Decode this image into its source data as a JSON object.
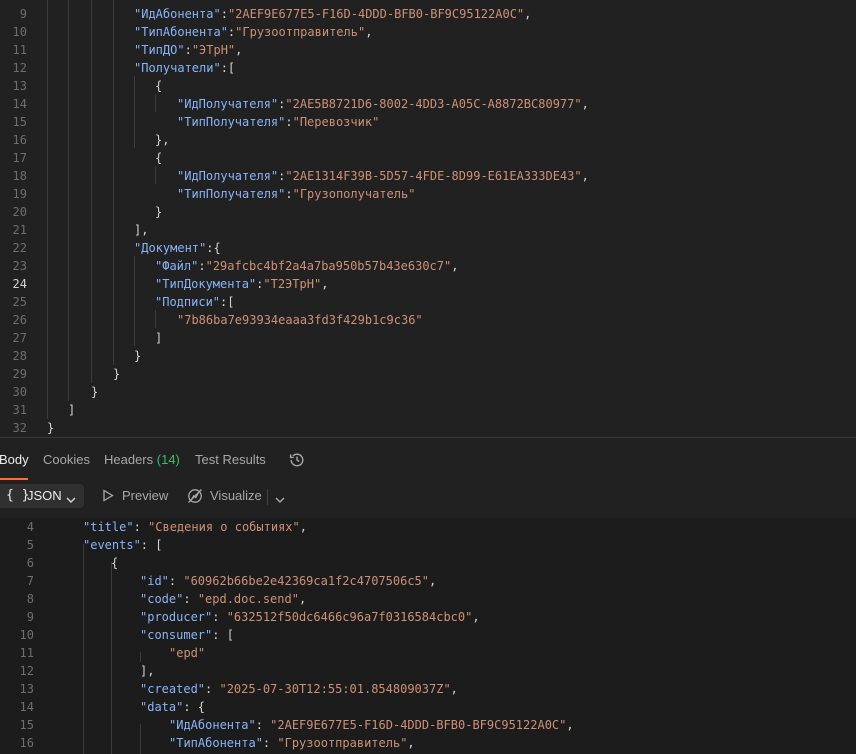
{
  "request_body": {
    "lines": [
      {
        "n": "9",
        "tokens": [
          [
            "k",
            "\"ИдАбонента\""
          ],
          [
            "p",
            ":"
          ],
          [
            "s",
            "\"2AEF9E677E5-F16D-4DDD-BFB0-BF9C95122A0C\""
          ],
          [
            "p",
            ","
          ]
        ]
      },
      {
        "n": "10",
        "tokens": [
          [
            "k",
            "\"ТипАбонента\""
          ],
          [
            "p",
            ":"
          ],
          [
            "s",
            "\"Грузоотправитель\""
          ],
          [
            "p",
            ","
          ]
        ]
      },
      {
        "n": "11",
        "tokens": [
          [
            "k",
            "\"ТипДО\""
          ],
          [
            "p",
            ":"
          ],
          [
            "s",
            "\"ЭТрН\""
          ],
          [
            "p",
            ","
          ]
        ]
      },
      {
        "n": "12",
        "tokens": [
          [
            "k",
            "\"Получатели\""
          ],
          [
            "p",
            ":["
          ]
        ]
      },
      {
        "n": "13",
        "tokens": [
          [
            "p",
            "{"
          ]
        ]
      },
      {
        "n": "14",
        "tokens": [
          [
            "k",
            "\"ИдПолучателя\""
          ],
          [
            "p",
            ":"
          ],
          [
            "s",
            "\"2AE5B8721D6-8002-4DD3-A05C-A8872BC80977\""
          ],
          [
            "p",
            ","
          ]
        ]
      },
      {
        "n": "15",
        "tokens": [
          [
            "k",
            "\"ТипПолучателя\""
          ],
          [
            "p",
            ":"
          ],
          [
            "s",
            "\"Перевозчик\""
          ]
        ]
      },
      {
        "n": "16",
        "tokens": [
          [
            "p",
            "},"
          ]
        ]
      },
      {
        "n": "17",
        "tokens": [
          [
            "p",
            "{"
          ]
        ]
      },
      {
        "n": "18",
        "tokens": [
          [
            "k",
            "\"ИдПолучателя\""
          ],
          [
            "p",
            ":"
          ],
          [
            "s",
            "\"2AE1314F39B-5D57-4FDE-8D99-E61EA333DE43\""
          ],
          [
            "p",
            ","
          ]
        ]
      },
      {
        "n": "19",
        "tokens": [
          [
            "k",
            "\"ТипПолучателя\""
          ],
          [
            "p",
            ":"
          ],
          [
            "s",
            "\"Грузополучатель\""
          ]
        ]
      },
      {
        "n": "20",
        "tokens": [
          [
            "p",
            "}"
          ]
        ]
      },
      {
        "n": "21",
        "tokens": [
          [
            "p",
            "],"
          ]
        ]
      },
      {
        "n": "22",
        "tokens": [
          [
            "k",
            "\"Документ\""
          ],
          [
            "p",
            ":{"
          ]
        ]
      },
      {
        "n": "23",
        "tokens": [
          [
            "k",
            "\"Файл\""
          ],
          [
            "p",
            ":"
          ],
          [
            "s",
            "\"29afcbc4bf2a4a7ba950b57b43e630c7\""
          ],
          [
            "p",
            ","
          ]
        ]
      },
      {
        "n": "24",
        "tokens": [
          [
            "k",
            "\"ТипДокумента\""
          ],
          [
            "p",
            ":"
          ],
          [
            "s",
            "\"Т2ЭТрН\""
          ],
          [
            "p",
            ","
          ]
        ]
      },
      {
        "n": "25",
        "tokens": [
          [
            "k",
            "\"Подписи\""
          ],
          [
            "p",
            ":["
          ]
        ]
      },
      {
        "n": "26",
        "tokens": [
          [
            "s",
            "\"7b86ba7e93934eaaa3fd3f429b1c9c36\""
          ]
        ]
      },
      {
        "n": "27",
        "tokens": [
          [
            "p",
            "]"
          ]
        ]
      },
      {
        "n": "28",
        "tokens": [
          [
            "p",
            "}"
          ]
        ]
      },
      {
        "n": "29",
        "tokens": [
          [
            "p",
            "}"
          ]
        ]
      },
      {
        "n": "30",
        "tokens": [
          [
            "p",
            "}"
          ]
        ]
      },
      {
        "n": "31",
        "tokens": [
          [
            "p",
            "]"
          ]
        ]
      },
      {
        "n": "32",
        "tokens": [
          [
            "p",
            "}"
          ]
        ]
      }
    ]
  },
  "tabs": {
    "body": "Body",
    "cookies": "Cookies",
    "headers": "Headers",
    "headers_count": "(14)",
    "test_results": "Test Results"
  },
  "toolbar": {
    "format_braces": "{ }",
    "format": "JSON",
    "preview": "Preview",
    "visualize": "Visualize"
  },
  "response_body": {
    "lines": [
      {
        "n": "4",
        "tokens": [
          [
            "k",
            "\"title\""
          ],
          [
            "p",
            ": "
          ],
          [
            "s",
            "\"Сведения о событиях\""
          ],
          [
            "p",
            ","
          ]
        ]
      },
      {
        "n": "5",
        "tokens": [
          [
            "k",
            "\"events\""
          ],
          [
            "p",
            ": ["
          ]
        ]
      },
      {
        "n": "6",
        "tokens": [
          [
            "p",
            "{"
          ]
        ]
      },
      {
        "n": "7",
        "tokens": [
          [
            "k",
            "\"id\""
          ],
          [
            "p",
            ": "
          ],
          [
            "s",
            "\"60962b66be2e42369ca1f2c4707506c5\""
          ],
          [
            "p",
            ","
          ]
        ]
      },
      {
        "n": "8",
        "tokens": [
          [
            "k",
            "\"code\""
          ],
          [
            "p",
            ": "
          ],
          [
            "s",
            "\"epd.doc.send\""
          ],
          [
            "p",
            ","
          ]
        ]
      },
      {
        "n": "9",
        "tokens": [
          [
            "k",
            "\"producer\""
          ],
          [
            "p",
            ": "
          ],
          [
            "s",
            "\"632512f50dc6466c96a7f0316584cbc0\""
          ],
          [
            "p",
            ","
          ]
        ]
      },
      {
        "n": "10",
        "tokens": [
          [
            "k",
            "\"consumer\""
          ],
          [
            "p",
            ": ["
          ]
        ]
      },
      {
        "n": "11",
        "tokens": [
          [
            "s",
            "\"epd\""
          ]
        ]
      },
      {
        "n": "12",
        "tokens": [
          [
            "p",
            "],"
          ]
        ]
      },
      {
        "n": "13",
        "tokens": [
          [
            "k",
            "\"created\""
          ],
          [
            "p",
            ": "
          ],
          [
            "s",
            "\"2025-07-30T12:55:01.854809037Z\""
          ],
          [
            "p",
            ","
          ]
        ]
      },
      {
        "n": "14",
        "tokens": [
          [
            "k",
            "\"data\""
          ],
          [
            "p",
            ": {"
          ]
        ]
      },
      {
        "n": "15",
        "tokens": [
          [
            "k",
            "\"ИдАбонента\""
          ],
          [
            "p",
            ": "
          ],
          [
            "s",
            "\"2AEF9E677E5-F16D-4DDD-BFB0-BF9C95122A0C\""
          ],
          [
            "p",
            ","
          ]
        ]
      },
      {
        "n": "16",
        "tokens": [
          [
            "k",
            "\"ТипАбонента\""
          ],
          [
            "p",
            ": "
          ],
          [
            "s",
            "\"Грузоотправитель\""
          ],
          [
            "p",
            ","
          ]
        ]
      }
    ]
  },
  "colors": {
    "key": "#8ab4f8",
    "string": "#ce9178",
    "punctuation": "#d4d4d4",
    "accent": "#ff6c37",
    "headers_count": "#3fb968"
  },
  "icons": {
    "history": "history-icon",
    "format_chevron": "chevron-down-icon",
    "preview": "play-icon",
    "visualize": "visualize-icon",
    "more": "chevron-down-icon"
  }
}
